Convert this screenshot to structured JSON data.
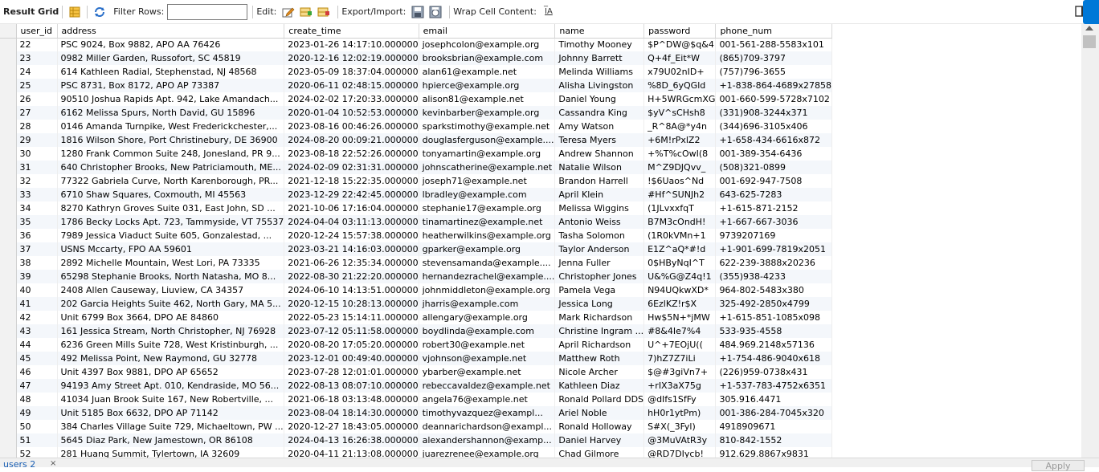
{
  "toolbar": {
    "result_grid": "Result Grid",
    "filter_rows": "Filter Rows:",
    "filter_value": "",
    "edit": "Edit:",
    "export_import": "Export/Import:",
    "wrap_cell_content": "Wrap Cell Content:",
    "wrap_icon_text": "I̅A"
  },
  "grid": {
    "columns": [
      "user_id",
      "address",
      "create_time",
      "email",
      "name",
      "password",
      "phone_num"
    ],
    "rows": [
      [
        "22",
        "PSC 9024, Box 9882, APO AA 76426",
        "2023-01-26 14:17:10.000000",
        "josephcolon@example.org",
        "Timothy Mooney",
        "$P^DW@$q&4",
        "001-561-288-5583x101"
      ],
      [
        "23",
        "0982 Miller Garden, Russofort, SC 45819",
        "2020-12-16 12:02:19.000000",
        "brooksbrian@example.com",
        "Johnny Barrett",
        "Q+4f_Eit*W",
        "(865)709-3797"
      ],
      [
        "24",
        "614 Kathleen Radial, Stephenstad, NJ 48568",
        "2023-05-09 18:37:04.000000",
        "alan61@example.net",
        "Melinda Williams",
        "x79U02nID+",
        "(757)796-3655"
      ],
      [
        "25",
        "PSC 8731, Box 8172, APO AP 73387",
        "2020-06-11 02:48:15.000000",
        "hpierce@example.org",
        "Alisha Livingston",
        "%8D_6yQGld",
        "+1-838-864-4689x27858"
      ],
      [
        "26",
        "90510 Joshua Rapids Apt. 942, Lake Amandach...",
        "2024-02-02 17:20:33.000000",
        "alison81@example.net",
        "Daniel Young",
        "H+5WRGcmXG",
        "001-660-599-5728x7102"
      ],
      [
        "27",
        "6162 Melissa Spurs, North David, GU 15896",
        "2020-01-04 10:52:53.000000",
        "kevinbarber@example.org",
        "Cassandra King",
        "$yV^sCHsh8",
        "(331)908-3244x371"
      ],
      [
        "28",
        "0146 Amanda Turnpike, West Frederickchester,...",
        "2023-08-16 00:46:26.000000",
        "sparkstimothy@example.net",
        "Amy Watson",
        "_R^8A@*y4n",
        "(344)696-3105x406"
      ],
      [
        "29",
        "1816 Wilson Shore, Port Christinebury, DE 36900",
        "2024-08-20 00:09:21.000000",
        "douglasferguson@example....",
        "Teresa Myers",
        "+6M!rPxlZ2",
        "+1-658-434-6616x872"
      ],
      [
        "30",
        "1280 Frank Common Suite 248, Jonesland, PR 9...",
        "2023-08-18 22:52:26.000000",
        "tonyamartin@example.org",
        "Andrew Shannon",
        "+%T%cOwI(8",
        "001-389-354-6436"
      ],
      [
        "31",
        "640 Christopher Brooks, New Patriciamouth, ME...",
        "2024-02-09 02:31:31.000000",
        "johnscatherine@example.net",
        "Natalie Wilson",
        "M^Z9DJQvv_",
        "(508)321-0899"
      ],
      [
        "32",
        "77322 Gabriela Curve, North Karenborough, PR...",
        "2021-12-18 15:22:35.000000",
        "joseph71@example.net",
        "Brandon Harrell",
        "!$6Uaos^Nd",
        "001-692-947-7508"
      ],
      [
        "33",
        "6710 Shaw Squares, Coxmouth, MI 45563",
        "2023-12-29 22:42:45.000000",
        "lbradley@example.com",
        "April Klein",
        "#Hf^SUNJh2",
        "643-625-7283"
      ],
      [
        "34",
        "8270 Kathryn Groves Suite 031, East John, SD ...",
        "2021-10-06 17:16:04.000000",
        "stephanie17@example.org",
        "Melissa Wiggins",
        "(1JLvxxfqT",
        "+1-615-871-2152"
      ],
      [
        "35",
        "1786 Becky Locks Apt. 723, Tammyside, VT 75537",
        "2024-04-04 03:11:13.000000",
        "tinamartinez@example.net",
        "Antonio Weiss",
        "B7M3cOndH!",
        "+1-667-667-3036"
      ],
      [
        "36",
        "7989 Jessica Viaduct Suite 605, Gonzalestad, ...",
        "2020-12-24 15:57:38.000000",
        "heatherwilkins@example.org",
        "Tasha Solomon",
        "(1R0kVMn+1",
        "9739207169"
      ],
      [
        "37",
        "USNS Mccarty, FPO AA 59601",
        "2023-03-21 14:16:03.000000",
        "gparker@example.org",
        "Taylor Anderson",
        "E1Z^aQ*#!d",
        "+1-901-699-7819x2051"
      ],
      [
        "38",
        "2892 Michelle Mountain, West Lori, PA 73335",
        "2021-06-26 12:35:34.000000",
        "stevensamanda@example....",
        "Jenna Fuller",
        "0$HByNqI^T",
        "622-239-3888x20236"
      ],
      [
        "39",
        "65298 Stephanie Brooks, North Natasha, MO 8...",
        "2022-08-30 21:22:20.000000",
        "hernandezrachel@example....",
        "Christopher Jones",
        "U&%G@Z4q!1",
        "(355)938-4233"
      ],
      [
        "40",
        "2408 Allen Causeway, Liuview, CA 34357",
        "2024-06-10 14:13:51.000000",
        "johnmiddleton@example.org",
        "Pamela Vega",
        "N94UQkwXD*",
        "964-802-5483x380"
      ],
      [
        "41",
        "202 Garcia Heights Suite 462, North Gary, MA 5...",
        "2020-12-15 10:28:13.000000",
        "jharris@example.com",
        "Jessica Long",
        "6EzlKZ!r$X",
        "325-492-2850x4799"
      ],
      [
        "42",
        "Unit 6799 Box 3664, DPO AE 84860",
        "2022-05-23 15:14:11.000000",
        "allengary@example.org",
        "Mark Richardson",
        "Hw$5N+*jMW",
        "+1-615-851-1085x098"
      ],
      [
        "43",
        "161 Jessica Stream, North Christopher, NJ 76928",
        "2023-07-12 05:11:58.000000",
        "boydlinda@example.com",
        "Christine Ingram ...",
        "#8&4Ie7%4",
        "533-935-4558"
      ],
      [
        "44",
        "6236 Green Mills Suite 728, West Kristinburgh, ...",
        "2020-08-20 17:05:20.000000",
        "robert30@example.net",
        "April Richardson",
        "U^+7EOjU((",
        "484.969.2148x57136"
      ],
      [
        "45",
        "492 Melissa Point, New Raymond, GU 32778",
        "2023-12-01 00:49:40.000000",
        "vjohnson@example.net",
        "Matthew Roth",
        "7)hZ7Z7iLi",
        "+1-754-486-9040x618"
      ],
      [
        "46",
        "Unit 4397 Box 9881, DPO AP 65652",
        "2023-07-28 12:01:01.000000",
        "ybarber@example.net",
        "Nicole Archer",
        "$@#3giVn7+",
        "(226)959-0738x431"
      ],
      [
        "47",
        "94193 Amy Street Apt. 010, Kendraside, MO 56...",
        "2022-08-13 08:07:10.000000",
        "rebeccavaldez@example.net",
        "Kathleen Diaz",
        "+rIX3aX75g",
        "+1-537-783-4752x6351"
      ],
      [
        "48",
        "41034 Juan Brook Suite 167, New Robertville, ...",
        "2021-06-18 03:13:48.000000",
        "angela76@example.net",
        "Ronald Pollard DDS",
        "@dIfs1SfFy",
        "305.916.4471"
      ],
      [
        "49",
        "Unit 5185 Box 6632, DPO AP 71142",
        "2023-08-04 18:14:30.000000",
        "timothyvazquez@exampl...",
        "Ariel Noble",
        "hH0r1ytPm)",
        "001-386-284-7045x320"
      ],
      [
        "50",
        "384 Charles Village Suite 729, Michaeltown, PW ...",
        "2020-12-27 18:43:05.000000",
        "deannarichardson@exampl...",
        "Ronald Holloway",
        "S#X(_3Fyl)",
        "4918909671"
      ],
      [
        "51",
        "5645 Diaz Park, New Jamestown, OR 86108",
        "2024-04-13 16:26:38.000000",
        "alexandershannon@examp...",
        "Daniel Harvey",
        "@3MuVAtR3y",
        "810-842-1552"
      ],
      [
        "52",
        "281 Huang Summit, Tylertown, IA 32609",
        "2020-04-11 21:13:08.000000",
        "juarezrenee@example.org",
        "Chad Gilmore",
        "@RD7DIycb!",
        "912.629.8867x9831"
      ]
    ]
  },
  "bottom": {
    "tab_label": "users 2",
    "tab_close": "×",
    "apply_label": "Apply"
  },
  "colors": {
    "accent": "#0078d7",
    "row_alt": "#f4f7fb"
  }
}
